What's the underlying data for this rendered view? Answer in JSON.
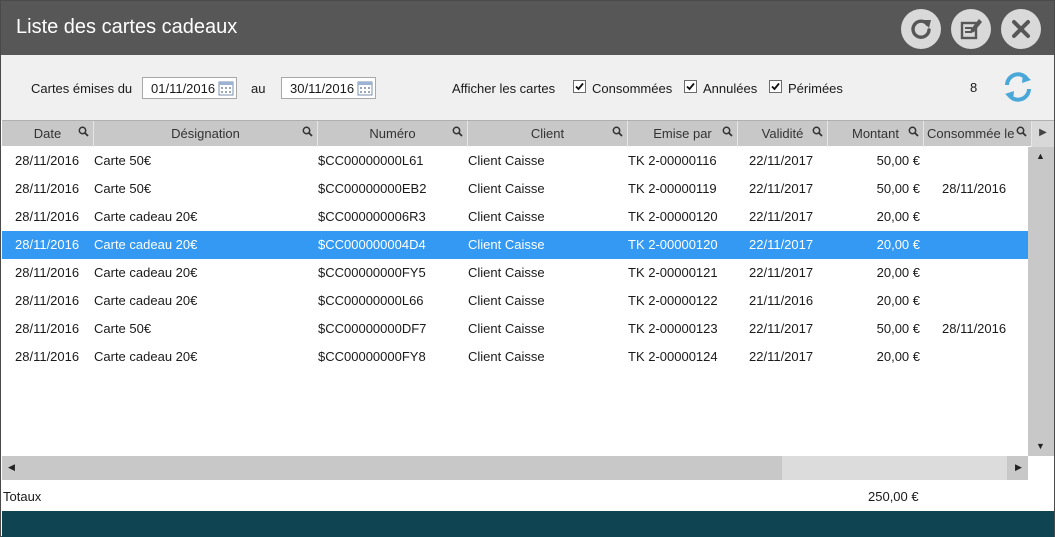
{
  "window": {
    "title": "Liste des cartes cadeaux"
  },
  "titlebar_buttons": [
    {
      "icon": "refresh-icon"
    },
    {
      "icon": "edit-icon"
    },
    {
      "icon": "close-icon"
    }
  ],
  "filters": {
    "issued_label": "Cartes émises du",
    "from_date": "01/11/2016",
    "to_label": "au",
    "to_date": "30/11/2016",
    "show_label": "Afficher les cartes",
    "checkbox_consumed": {
      "label": "Consommées",
      "checked": true
    },
    "checkbox_cancelled": {
      "label": "Annulées",
      "checked": true
    },
    "checkbox_expired": {
      "label": "Périmées",
      "checked": true
    },
    "count": "8"
  },
  "columns": [
    "Date",
    "Désignation",
    "Numéro",
    "Client",
    "Emise par",
    "Validité",
    "Montant",
    "Consommée le"
  ],
  "rows": [
    {
      "date": "28/11/2016",
      "designation": "Carte 50€",
      "numero": "$CC00000000L61",
      "client": "Client Caisse",
      "emise_par": "TK 2-00000116",
      "validite": "22/11/2017",
      "montant": "50,00 €",
      "consommee": ""
    },
    {
      "date": "28/11/2016",
      "designation": "Carte 50€",
      "numero": "$CC00000000EB2",
      "client": "Client Caisse",
      "emise_par": "TK 2-00000119",
      "validite": "22/11/2017",
      "montant": "50,00 €",
      "consommee": "28/11/2016"
    },
    {
      "date": "28/11/2016",
      "designation": "Carte cadeau 20€",
      "numero": "$CC000000006R3",
      "client": "Client Caisse",
      "emise_par": "TK 2-00000120",
      "validite": "22/11/2017",
      "montant": "20,00 €",
      "consommee": ""
    },
    {
      "date": "28/11/2016",
      "designation": "Carte cadeau 20€",
      "numero": "$CC000000004D4",
      "client": "Client Caisse",
      "emise_par": "TK 2-00000120",
      "validite": "22/11/2017",
      "montant": "20,00 €",
      "consommee": "",
      "selected": true
    },
    {
      "date": "28/11/2016",
      "designation": "Carte cadeau 20€",
      "numero": "$CC00000000FY5",
      "client": "Client Caisse",
      "emise_par": "TK 2-00000121",
      "validite": "22/11/2017",
      "montant": "20,00 €",
      "consommee": ""
    },
    {
      "date": "28/11/2016",
      "designation": "Carte cadeau 20€",
      "numero": "$CC00000000L66",
      "client": "Client Caisse",
      "emise_par": "TK 2-00000122",
      "validite": "21/11/2016",
      "montant": "20,00 €",
      "consommee": ""
    },
    {
      "date": "28/11/2016",
      "designation": "Carte 50€",
      "numero": "$CC00000000DF7",
      "client": "Client Caisse",
      "emise_par": "TK 2-00000123",
      "validite": "22/11/2017",
      "montant": "50,00 €",
      "consommee": "28/11/2016"
    },
    {
      "date": "28/11/2016",
      "designation": "Carte cadeau 20€",
      "numero": "$CC00000000FY8",
      "client": "Client Caisse",
      "emise_par": "TK 2-00000124",
      "validite": "22/11/2017",
      "montant": "20,00 €",
      "consommee": ""
    }
  ],
  "totals": {
    "label": "Totaux",
    "montant": "250,00 €"
  },
  "colors": {
    "titlebar": "#575757",
    "selected_row": "#3399f3",
    "footer": "#0f4452",
    "accent_refresh": "#4aa8d8"
  }
}
